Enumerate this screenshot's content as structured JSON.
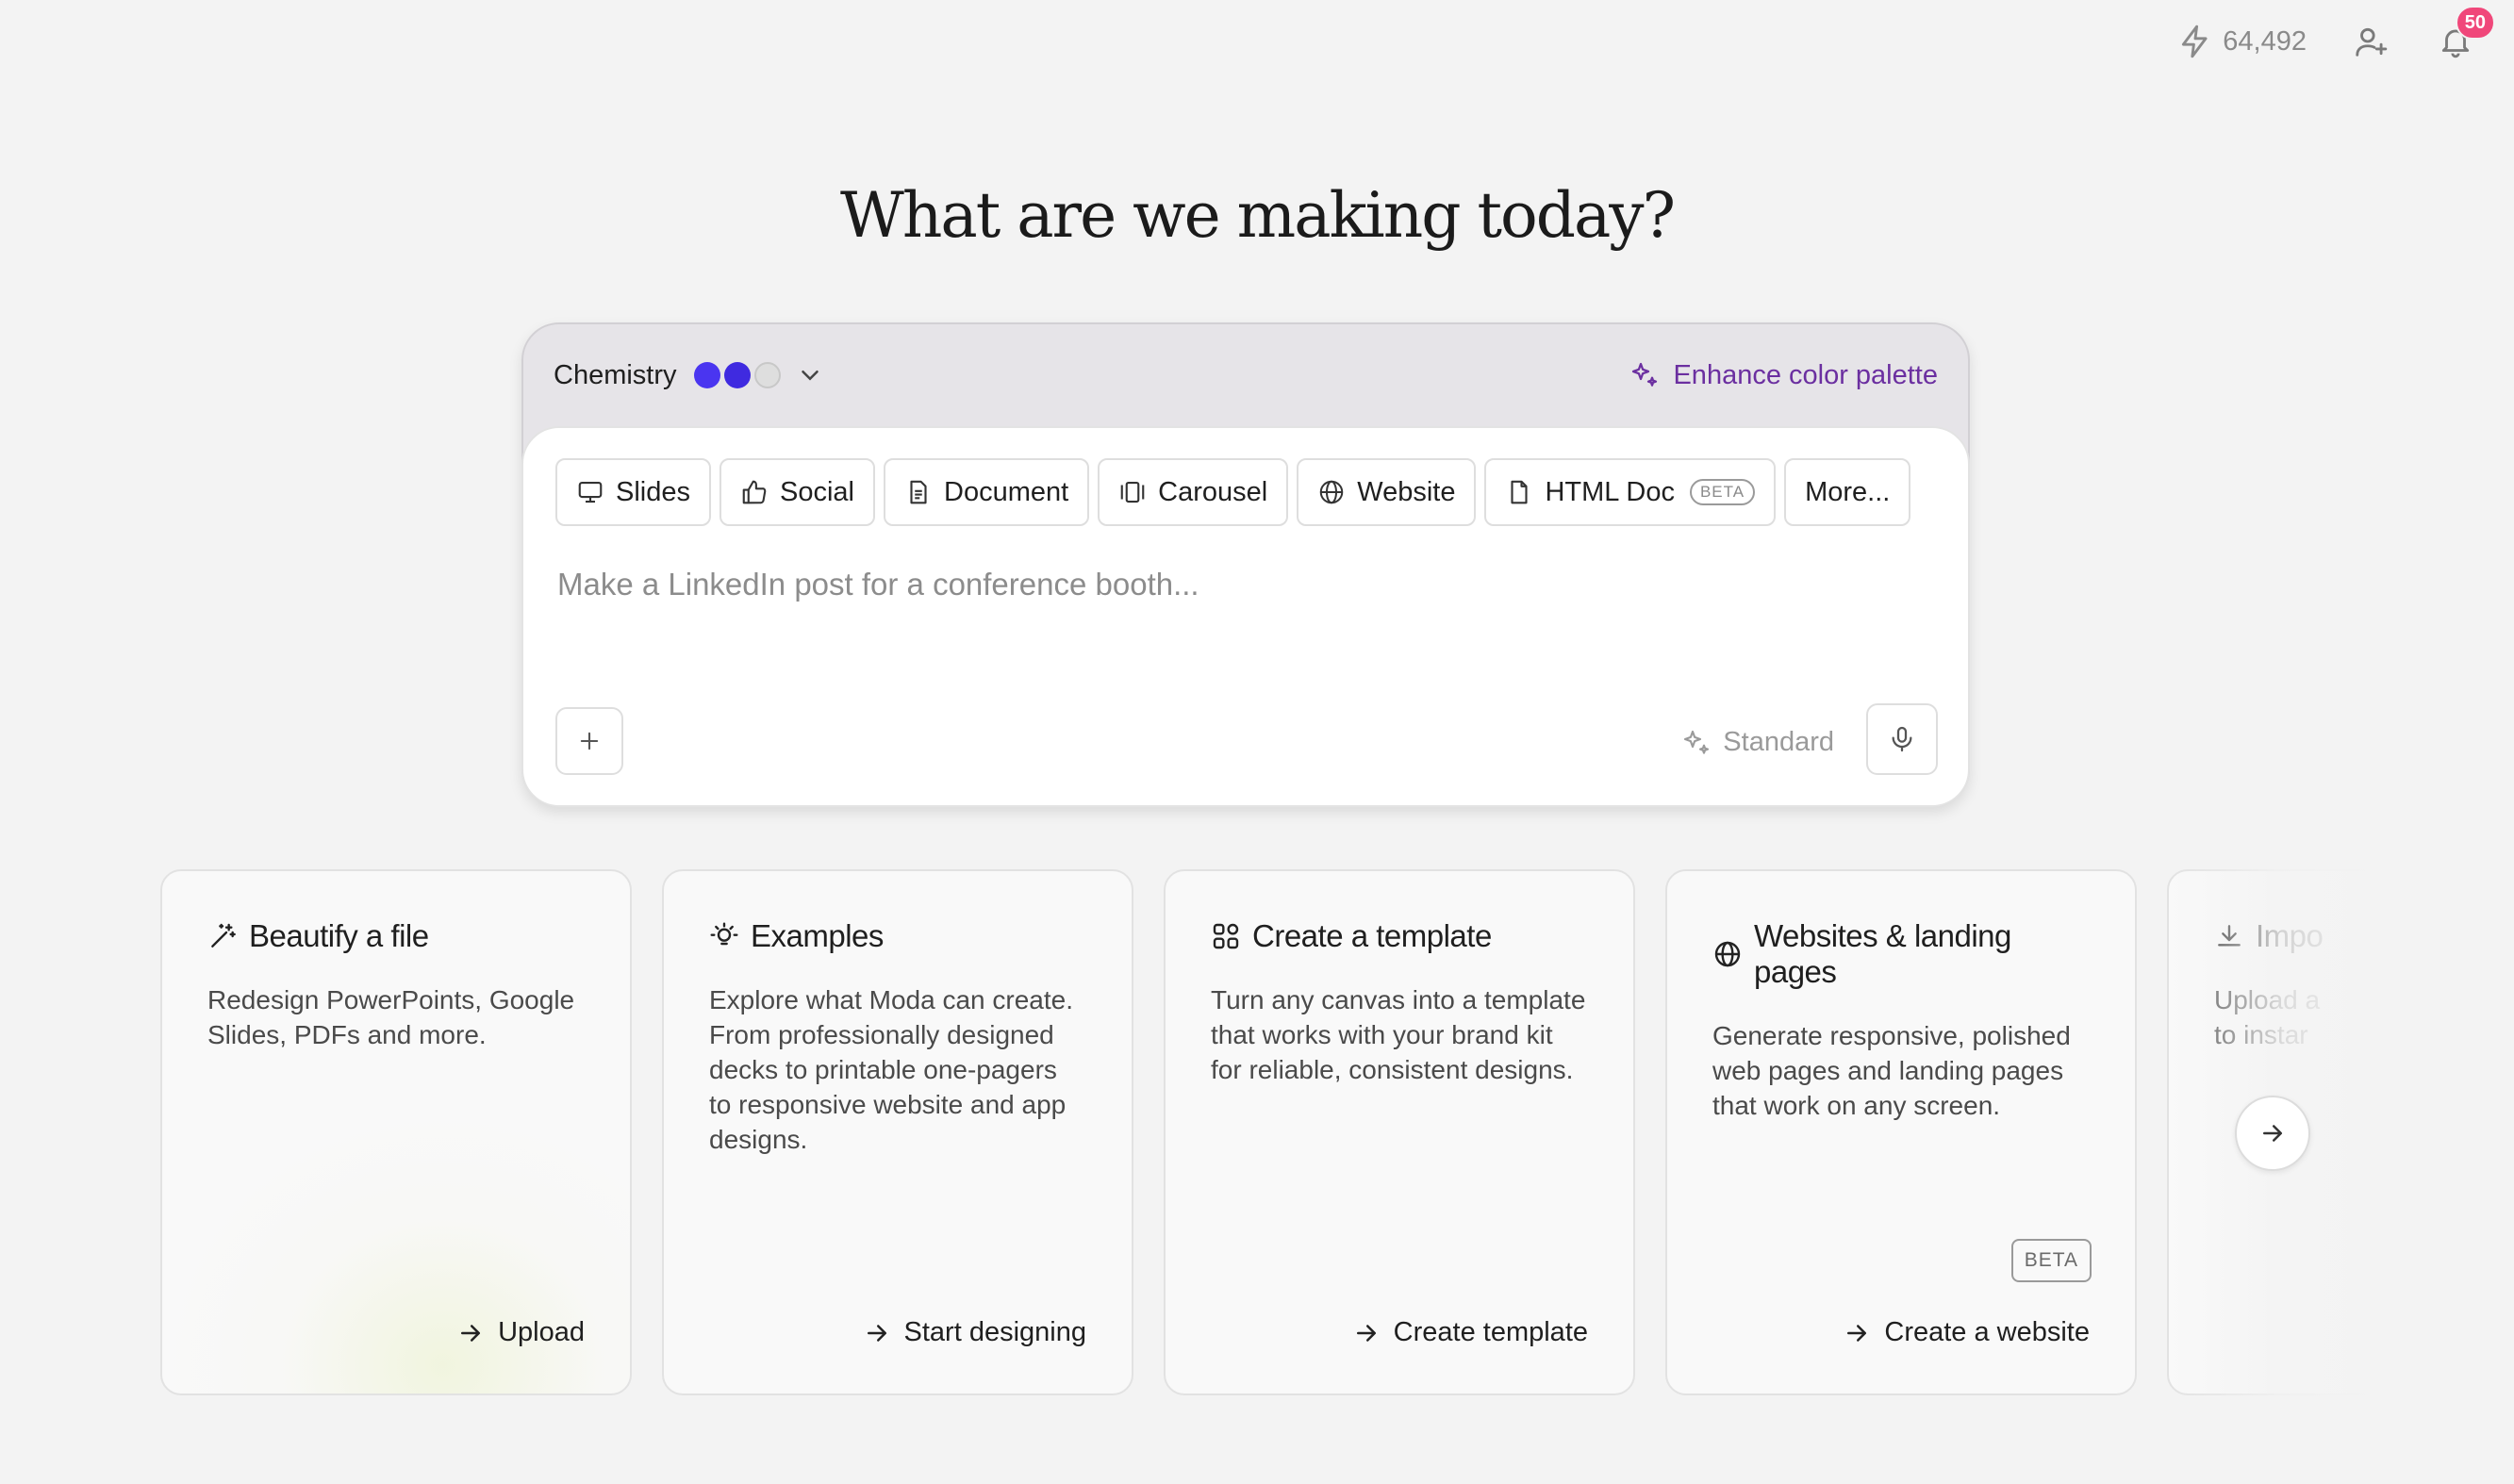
{
  "topbar": {
    "credits": "64,492",
    "notifications_count": "50",
    "icons": {
      "credits": "lightning-icon",
      "invite": "user-plus-icon",
      "notifications": "bell-icon"
    }
  },
  "heading": "What are we making today?",
  "prompt_panel": {
    "theme": {
      "name": "Chemistry",
      "colors": [
        "#4a35f0",
        "#3f2ae0",
        "#dedede"
      ]
    },
    "enhance_label": "Enhance color palette",
    "chips": [
      {
        "label": "Slides",
        "icon": "presentation-icon"
      },
      {
        "label": "Social",
        "icon": "thumbs-up-icon"
      },
      {
        "label": "Document",
        "icon": "document-icon"
      },
      {
        "label": "Carousel",
        "icon": "carousel-icon"
      },
      {
        "label": "Website",
        "icon": "globe-icon"
      },
      {
        "label": "HTML Doc",
        "icon": "file-icon",
        "badge": "BETA"
      },
      {
        "label": "More..."
      }
    ],
    "placeholder": "Make a LinkedIn post for a conference booth...",
    "quality_label": "Standard"
  },
  "cards": [
    {
      "title": "Beautify a file",
      "icon": "magic-wand-icon",
      "description": "Redesign PowerPoints, Google Slides, PDFs and more.",
      "action": "Upload"
    },
    {
      "title": "Examples",
      "icon": "lightbulb-icon",
      "description": "Explore what Moda can create. From professionally designed decks to printable one-pagers to responsive website and app designs.",
      "action": "Start designing"
    },
    {
      "title": "Create a template",
      "icon": "grid-icon",
      "description": "Turn any canvas into a template that works with your brand kit for reliable, consistent designs.",
      "action": "Create template"
    },
    {
      "title": "Websites & landing pages",
      "icon": "globe-icon",
      "description": "Generate responsive, polished web pages and landing pages that work on any screen.",
      "badge": "BETA",
      "action": "Create a website"
    },
    {
      "title": "Impo",
      "icon": "download-icon",
      "description": "Upload a\nto instar"
    }
  ]
}
